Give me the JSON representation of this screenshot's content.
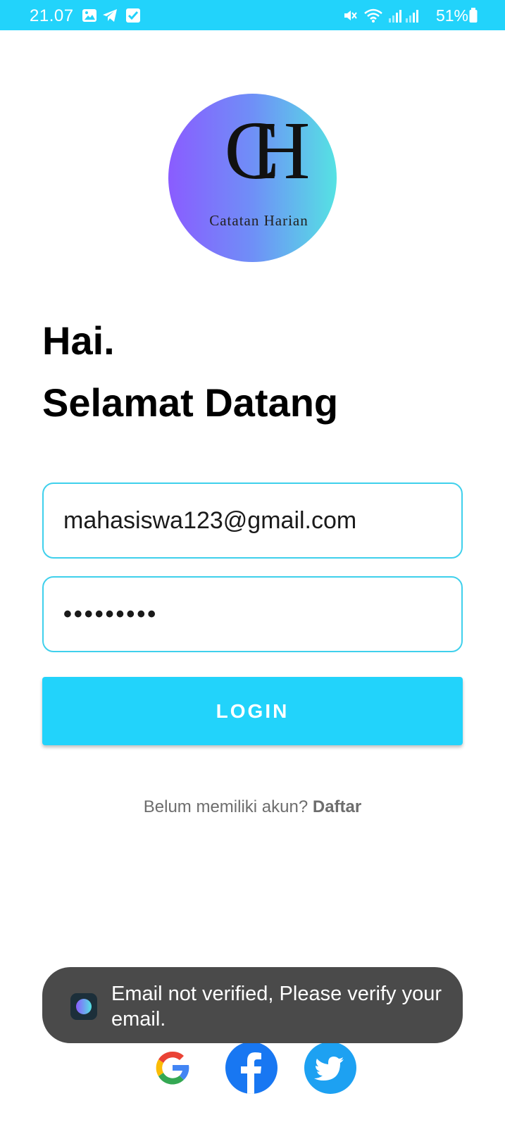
{
  "status_bar": {
    "time": "21.07",
    "battery": "51%",
    "left_icons": [
      "gallery-icon",
      "telegram-icon",
      "check-box-icon"
    ],
    "right_icons": [
      "mute-icon",
      "wifi-icon",
      "signal-icon",
      "signal-icon",
      "battery-icon"
    ],
    "color": "#22d3fb"
  },
  "logo": {
    "monogram": "CH",
    "name": "Catatan Harian"
  },
  "greeting": {
    "line1": "Hai.",
    "line2": "Selamat Datang"
  },
  "form": {
    "email_value": "mahasiswa123@gmail.com",
    "password_value": "•••••••••",
    "login_label": "LOGIN"
  },
  "register": {
    "prompt": "Belum memiliki akun?",
    "link": "Daftar"
  },
  "social": [
    "google-icon",
    "facebook-icon",
    "twitter-icon"
  ],
  "toast": {
    "message": "Email not verified, Please verify your email."
  },
  "colors": {
    "accent": "#22d3fb",
    "field_border": "#3fd0ec",
    "toast_bg": "#4a4a4a"
  }
}
